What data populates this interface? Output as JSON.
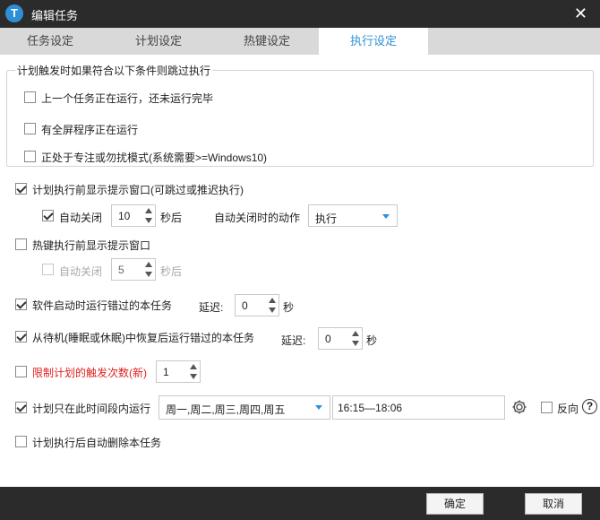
{
  "window": {
    "title": "编辑任务",
    "app_icon_letter": "T"
  },
  "tabs": [
    {
      "label": "任务设定"
    },
    {
      "label": "计划设定"
    },
    {
      "label": "热键设定"
    },
    {
      "label": "执行设定",
      "active": true
    }
  ],
  "skip_group": {
    "legend": "计划触发时如果符合以下条件则跳过执行",
    "options": [
      {
        "label": "上一个任务正在运行，还未运行完毕",
        "checked": false
      },
      {
        "label": "有全屏程序正在运行",
        "checked": false
      },
      {
        "label": "正处于专注或勿扰模式(系统需要>=Windows10)",
        "checked": false
      }
    ]
  },
  "plan_prompt": {
    "label": "计划执行前显示提示窗口(可跳过或推迟执行)",
    "checked": true,
    "auto_close_label": "自动关闭",
    "auto_close_checked": true,
    "seconds_value": "10",
    "seconds_unit": "秒后",
    "action_label": "自动关闭时的动作",
    "action_value": "执行"
  },
  "hotkey_prompt": {
    "label": "热键执行前显示提示窗口",
    "checked": false,
    "auto_close_label": "自动关闭",
    "auto_close_checked": false,
    "seconds_value": "5",
    "seconds_unit": "秒后"
  },
  "startup_missed": {
    "label": "软件启动时运行错过的本任务",
    "checked": true,
    "delay_label": "延迟:",
    "delay_value": "0",
    "unit": "秒"
  },
  "resume_missed": {
    "label": "从待机(睡眠或休眠)中恢复后运行错过的本任务",
    "checked": true,
    "delay_label": "延迟:",
    "delay_value": "0",
    "unit": "秒"
  },
  "limit_triggers": {
    "label": "限制计划的触发次数(新)",
    "checked": false,
    "value": "1",
    "color": "#e02020"
  },
  "time_window": {
    "label": "计划只在此时间段内运行",
    "checked": true,
    "days_value": "周一,周二,周三,周四,周五",
    "time_value": "16:15—18:06",
    "reverse_label": "反向",
    "reverse_checked": false,
    "help_glyph": "?"
  },
  "auto_delete": {
    "label": "计划执行后自动删除本任务",
    "checked": false
  },
  "footer": {
    "ok_label": "确定",
    "cancel_label": "取消"
  },
  "colors": {
    "accent": "#2e8fd6",
    "titlebar": "#2b2b2b",
    "tabbar": "#d9d9d9",
    "warning": "#e02020"
  },
  "icons": {
    "close": "close-icon",
    "gear": "gear-icon",
    "help": "help-icon",
    "app": "app-logo-icon"
  }
}
